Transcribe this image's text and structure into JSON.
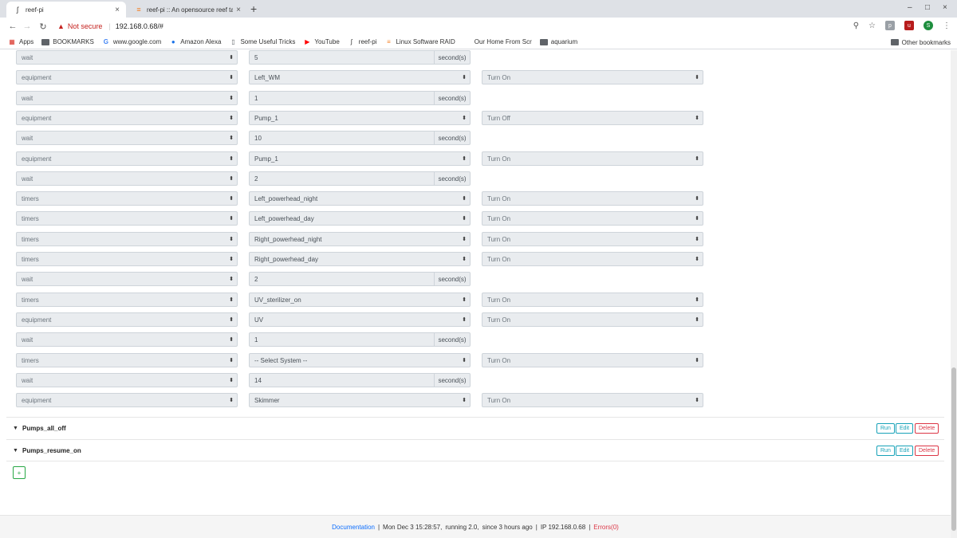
{
  "browser": {
    "tabs": [
      {
        "title": "reef-pi",
        "active": true,
        "favicon": "reef-pi-icon"
      },
      {
        "title": "reef-pi :: An opensource reef ta",
        "active": false,
        "favicon": "stack-icon"
      }
    ],
    "not_secure": "Not secure",
    "url": "192.168.0.68/#",
    "bookmarks": [
      {
        "label": "Apps",
        "icon": "apps-grid-icon"
      },
      {
        "label": "BOOKMARKS",
        "icon": "folder-icon"
      },
      {
        "label": "www.google.com",
        "icon": "google-icon"
      },
      {
        "label": "Amazon Alexa",
        "icon": "alexa-icon"
      },
      {
        "label": "Some Useful Tricks",
        "icon": "page-icon"
      },
      {
        "label": "YouTube",
        "icon": "youtube-icon"
      },
      {
        "label": "reef-pi",
        "icon": "reef-pi-icon"
      },
      {
        "label": "Linux Software RAID",
        "icon": "stack-icon"
      },
      {
        "label": "Our Home From Scr",
        "icon": "blank-icon"
      },
      {
        "label": "aquarium",
        "icon": "folder-icon"
      }
    ],
    "other_bookmarks": "Other bookmarks",
    "avatar_letter": "S",
    "colors": {
      "warning": "#c5221f",
      "avatar": "#1e8e3e"
    }
  },
  "steps": [
    {
      "type": "wait",
      "value": "5",
      "unit": "second(s)"
    },
    {
      "type": "equipment",
      "target": "Left_WM",
      "action": "Turn On"
    },
    {
      "type": "wait",
      "value": "1",
      "unit": "second(s)"
    },
    {
      "type": "equipment",
      "target": "Pump_1",
      "action": "Turn Off"
    },
    {
      "type": "wait",
      "value": "10",
      "unit": "second(s)"
    },
    {
      "type": "equipment",
      "target": "Pump_1",
      "action": "Turn On"
    },
    {
      "type": "wait",
      "value": "2",
      "unit": "second(s)"
    },
    {
      "type": "timers",
      "target": "Left_powerhead_night",
      "action": "Turn On"
    },
    {
      "type": "timers",
      "target": "Left_powerhead_day",
      "action": "Turn On"
    },
    {
      "type": "timers",
      "target": "Right_powerhead_night",
      "action": "Turn On"
    },
    {
      "type": "timers",
      "target": "Right_powerhead_day",
      "action": "Turn On"
    },
    {
      "type": "wait",
      "value": "2",
      "unit": "second(s)"
    },
    {
      "type": "timers",
      "target": "UV_sterilizer_on",
      "action": "Turn On"
    },
    {
      "type": "equipment",
      "target": "UV",
      "action": "Turn On"
    },
    {
      "type": "wait",
      "value": "1",
      "unit": "second(s)"
    },
    {
      "type": "timers",
      "target": "-- Select System --",
      "action": "Turn On"
    },
    {
      "type": "wait",
      "value": "14",
      "unit": "second(s)"
    },
    {
      "type": "equipment",
      "target": "Skimmer",
      "action": "Turn On"
    }
  ],
  "macros": [
    {
      "name": "Pumps_all_off",
      "run": "Run",
      "edit": "Edit",
      "delete": "Delete"
    },
    {
      "name": "Pumps_resume_on",
      "run": "Run",
      "edit": "Edit",
      "delete": "Delete"
    }
  ],
  "add_button": "+",
  "footer": {
    "documentation": "Documentation",
    "sep": "|",
    "time": "Mon Dec 3 15:28:57,",
    "running": "running 2.0,",
    "uptime": "since 3 hours ago",
    "ip": "IP 192.168.0.68",
    "errors": "Errors(0)"
  }
}
